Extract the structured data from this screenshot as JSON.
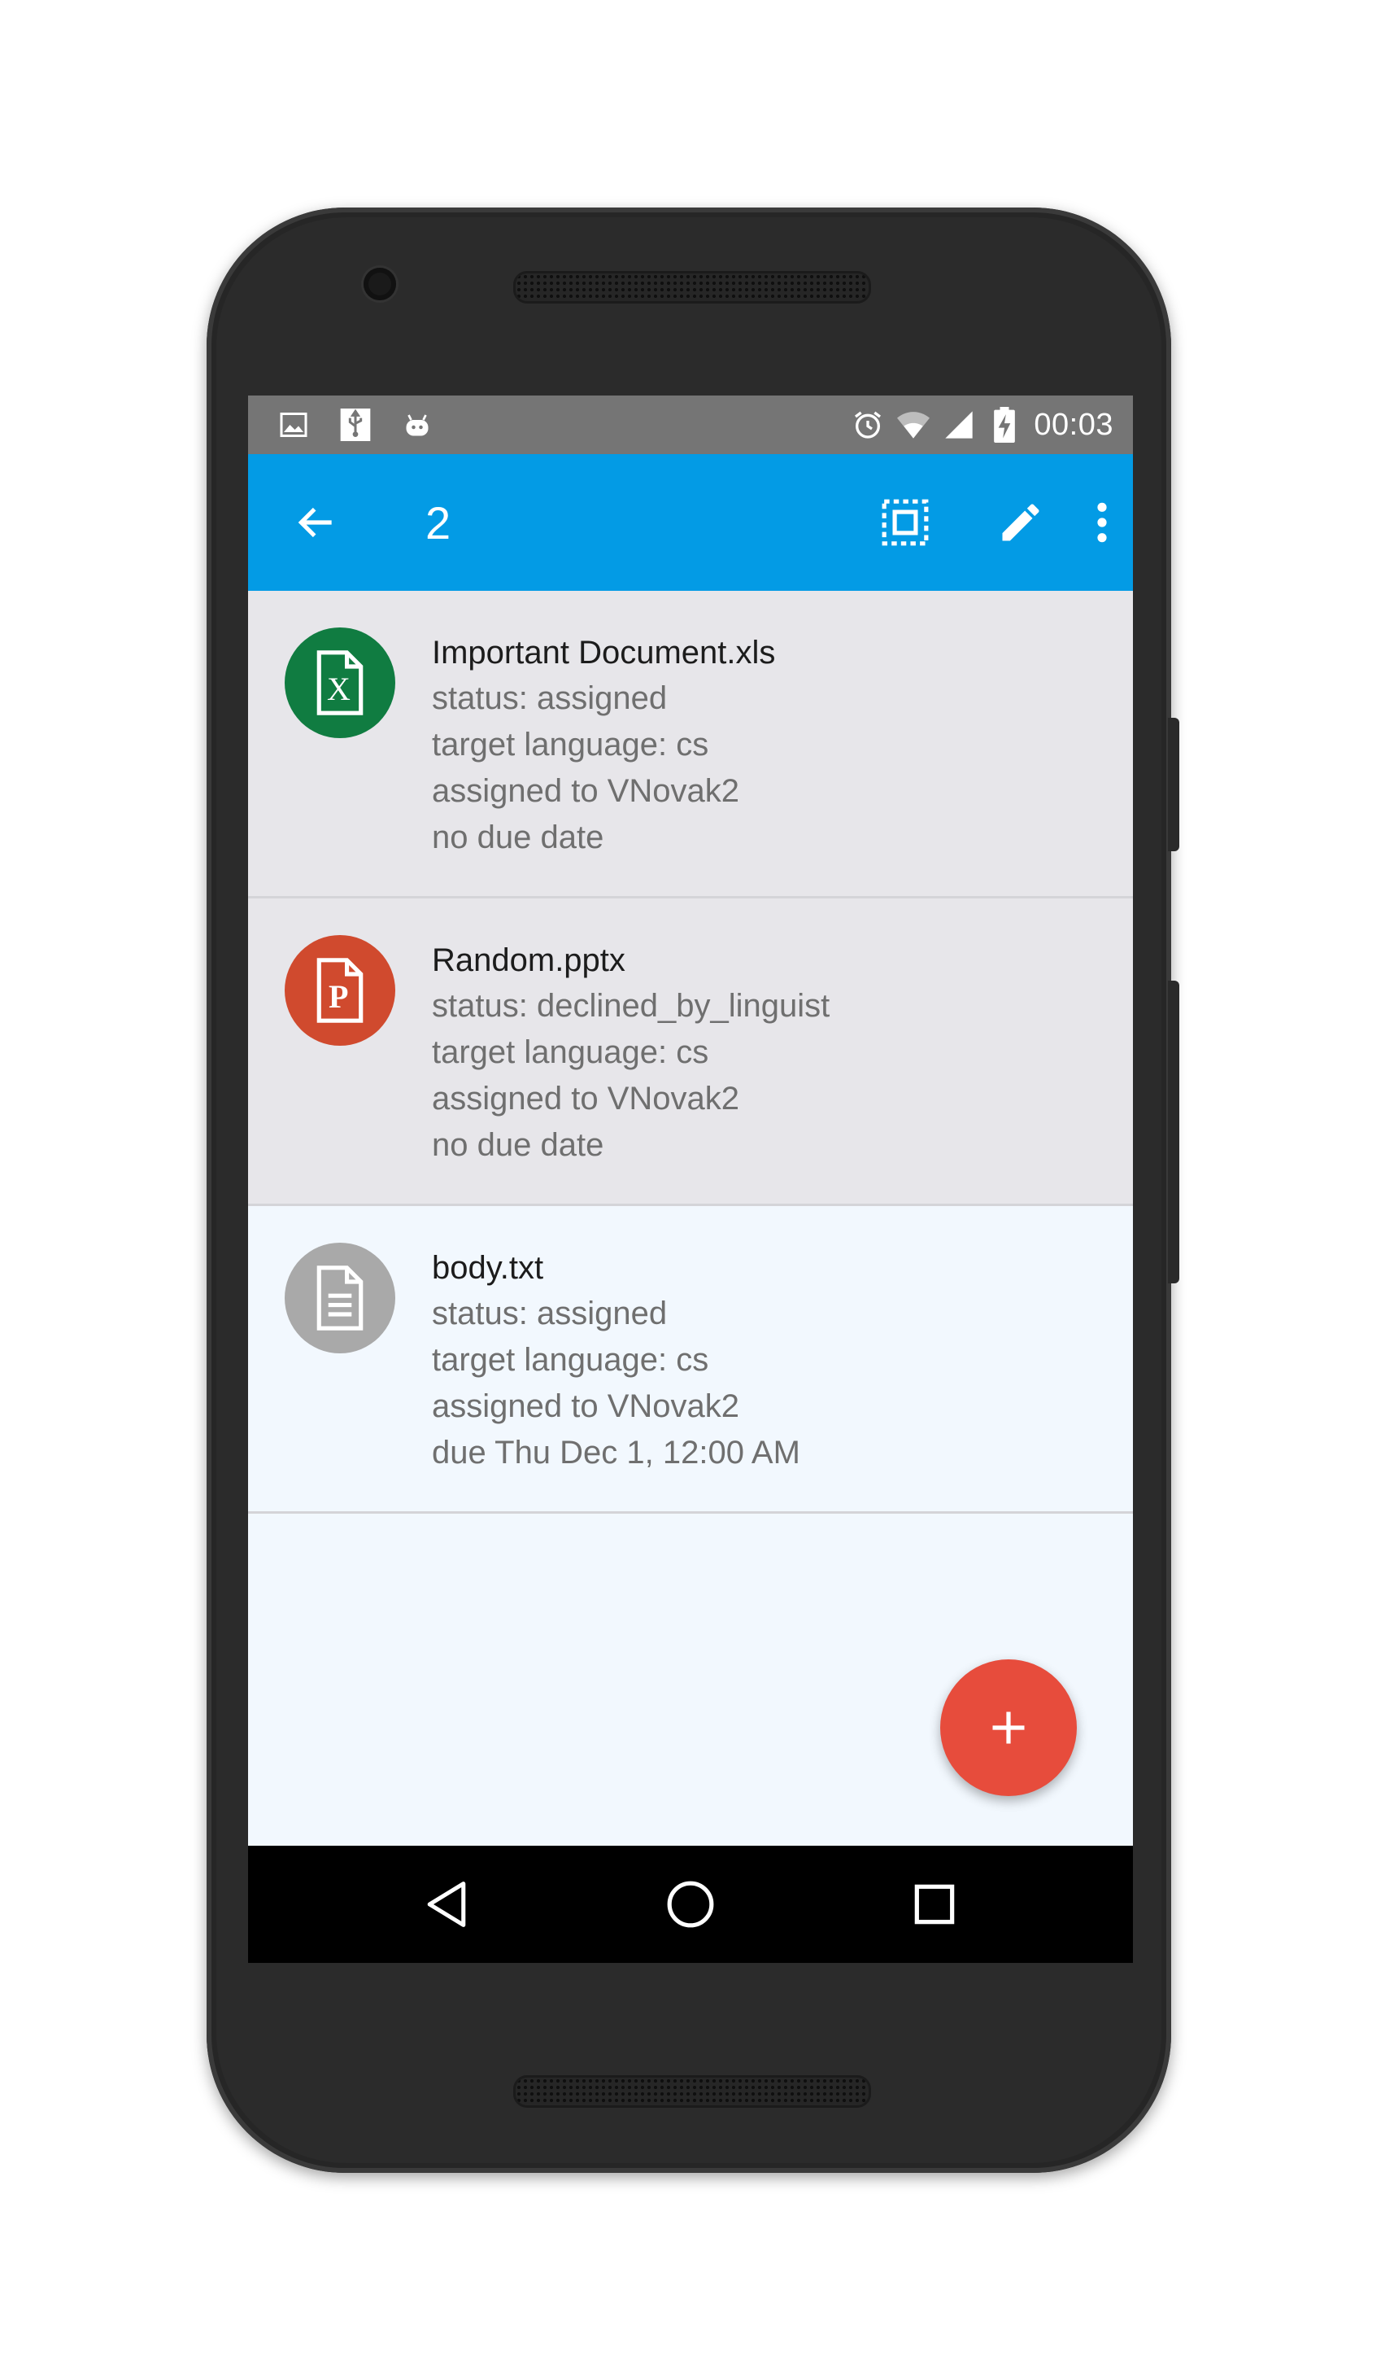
{
  "statusbar": {
    "left_icons": [
      "image-icon",
      "usb-icon",
      "android-debug-icon"
    ],
    "right_icons": [
      "alarm-icon",
      "wifi-icon",
      "signal-icon",
      "battery-charging-icon"
    ],
    "time": "00:03"
  },
  "appbar": {
    "back_icon": "arrow-back-icon",
    "title": "2",
    "actions": [
      "select-all-icon",
      "edit-icon",
      "more-vert-icon"
    ]
  },
  "documents": [
    {
      "name": "Important Document.xls",
      "icon": "excel-file-icon",
      "icon_color": "#107c41",
      "icon_letter": "X",
      "status": "status: assigned",
      "language": "target language: cs",
      "assignee": "assigned to VNovak2",
      "due": "no due date",
      "selected": true
    },
    {
      "name": "Random.pptx",
      "icon": "powerpoint-file-icon",
      "icon_color": "#d04a2e",
      "icon_letter": "P",
      "status": "status: declined_by_linguist",
      "language": "target language: cs",
      "assignee": "assigned to VNovak2",
      "due": "no due date",
      "selected": true
    },
    {
      "name": "body.txt",
      "icon": "text-file-icon",
      "icon_color": "#a9a9a9",
      "status": "status: assigned",
      "language": "target language: cs",
      "assignee": "assigned to VNovak2",
      "due": "due Thu Dec 1, 12:00 AM",
      "selected": false
    }
  ],
  "fab": {
    "icon": "add-icon",
    "color": "#e74c3c"
  },
  "navbar": {
    "icons": [
      "back-triangle-icon",
      "home-circle-icon",
      "recents-square-icon"
    ]
  },
  "colors": {
    "appbar": "#039be5",
    "statusbar": "#757575",
    "selected_row": "#e7e6ea",
    "list_bg": "#f2f8fe"
  }
}
